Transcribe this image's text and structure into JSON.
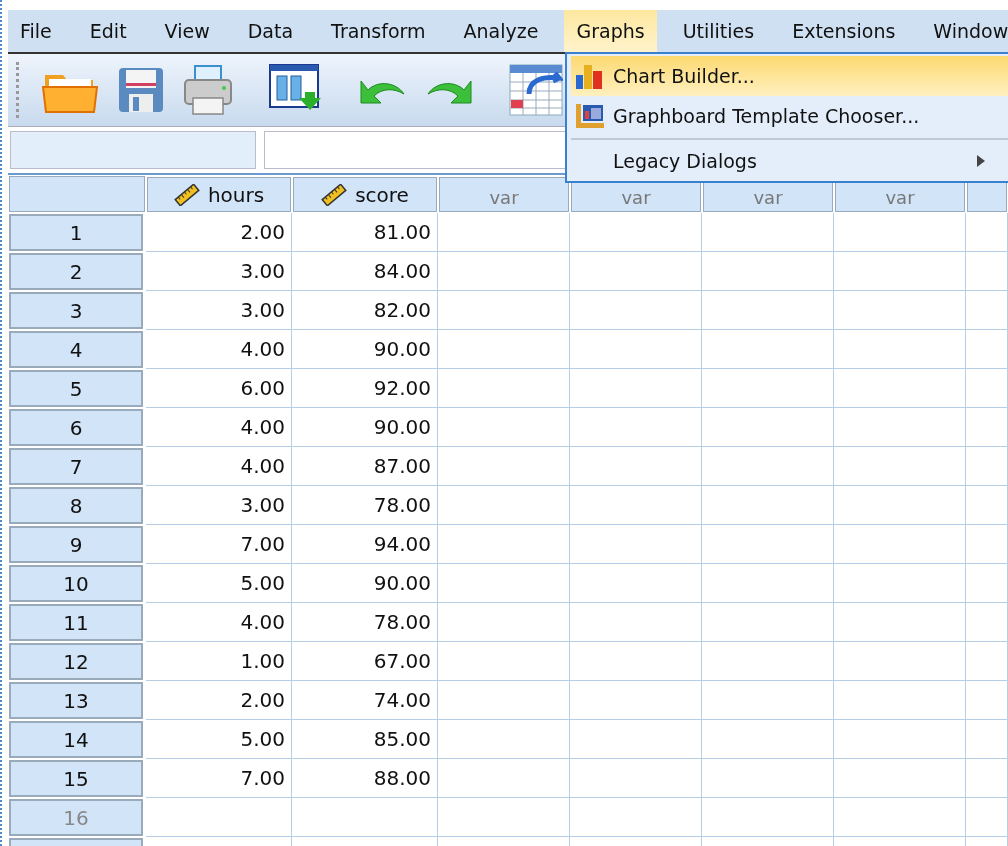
{
  "menu_bar": [
    {
      "label": "File",
      "selected": false
    },
    {
      "label": "Edit",
      "selected": false
    },
    {
      "label": "View",
      "selected": false
    },
    {
      "label": "Data",
      "selected": false
    },
    {
      "label": "Transform",
      "selected": false
    },
    {
      "label": "Analyze",
      "selected": false
    },
    {
      "label": "Graphs",
      "selected": true
    },
    {
      "label": "Utilities",
      "selected": false
    },
    {
      "label": "Extensions",
      "selected": false
    },
    {
      "label": "Window",
      "selected": false
    }
  ],
  "toolbar": [
    {
      "kind": "open"
    },
    {
      "kind": "save"
    },
    {
      "kind": "print"
    },
    {
      "kind": "dialog"
    },
    {
      "kind": "undo"
    },
    {
      "kind": "redo"
    },
    {
      "kind": "goto"
    }
  ],
  "graphs_menu": [
    {
      "kind": "chart",
      "label": "Chart Builder...",
      "selected": true
    },
    {
      "kind": "graphboard",
      "label": "Graphboard Template Chooser...",
      "selected": false
    },
    {
      "kind": "submenu",
      "label": "Legacy Dialogs",
      "selected": false
    }
  ],
  "columns": [
    {
      "kind": "scale",
      "label": "hours"
    },
    {
      "kind": "scale",
      "label": "score"
    },
    {
      "kind": "empty",
      "label": "var"
    },
    {
      "kind": "empty",
      "label": "var"
    },
    {
      "kind": "empty",
      "label": "var"
    },
    {
      "kind": "empty",
      "label": "var"
    }
  ],
  "rows": [
    {
      "case": "1",
      "values": [
        "2.00",
        "81.00"
      ],
      "disabled": false
    },
    {
      "case": "2",
      "values": [
        "3.00",
        "84.00"
      ],
      "disabled": false
    },
    {
      "case": "3",
      "values": [
        "3.00",
        "82.00"
      ],
      "disabled": false
    },
    {
      "case": "4",
      "values": [
        "4.00",
        "90.00"
      ],
      "disabled": false
    },
    {
      "case": "5",
      "values": [
        "6.00",
        "92.00"
      ],
      "disabled": false
    },
    {
      "case": "6",
      "values": [
        "4.00",
        "90.00"
      ],
      "disabled": false
    },
    {
      "case": "7",
      "values": [
        "4.00",
        "87.00"
      ],
      "disabled": false
    },
    {
      "case": "8",
      "values": [
        "3.00",
        "78.00"
      ],
      "disabled": false
    },
    {
      "case": "9",
      "values": [
        "7.00",
        "94.00"
      ],
      "disabled": false
    },
    {
      "case": "10",
      "values": [
        "5.00",
        "90.00"
      ],
      "disabled": false
    },
    {
      "case": "11",
      "values": [
        "4.00",
        "78.00"
      ],
      "disabled": false
    },
    {
      "case": "12",
      "values": [
        "1.00",
        "67.00"
      ],
      "disabled": false
    },
    {
      "case": "13",
      "values": [
        "2.00",
        "74.00"
      ],
      "disabled": false
    },
    {
      "case": "14",
      "values": [
        "5.00",
        "85.00"
      ],
      "disabled": false
    },
    {
      "case": "15",
      "values": [
        "7.00",
        "88.00"
      ],
      "disabled": false
    },
    {
      "case": "16",
      "values": [],
      "disabled": true
    }
  ]
}
